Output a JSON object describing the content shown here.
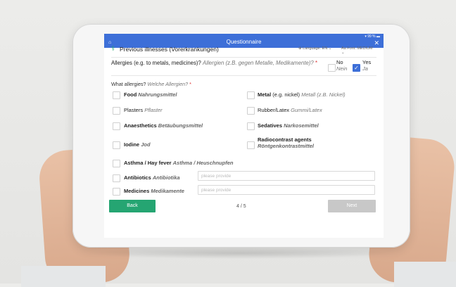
{
  "header": {
    "title": "Questionnaire",
    "status": "▾ 99 % ▬"
  },
  "section": {
    "title": "Previous illnesses (Vorerkrankungen)",
    "language": "Language: EN",
    "font": "Font: MEDIUM"
  },
  "q1": {
    "label_en": "Allergies (e.g. to metals, medicines)?",
    "label_de": "Allergien (z.B. gegen Metalle, Medikamente)?",
    "required": "*",
    "no_en": "No",
    "no_de": "Nein",
    "yes_en": "Yes",
    "yes_de": "Ja",
    "selected": "Yes"
  },
  "q2": {
    "label_en": "What allergies?",
    "label_de": "Welche Allergien?",
    "required": "*"
  },
  "options": {
    "food": {
      "en": "Food",
      "de": "Nahrungsmittel"
    },
    "metal": {
      "en": "Metal",
      "mid": "(e.g. nickel)",
      "de": "Metall (z.B. Nickel)"
    },
    "plasters": {
      "en": "Plasters",
      "de": "Pflaster"
    },
    "rubber": {
      "en": "Rubber/Latex",
      "de": "Gummi/Latex"
    },
    "anaesthetics": {
      "en": "Anaesthetics",
      "de": "Betäubungsmittel"
    },
    "sedatives": {
      "en": "Sedatives",
      "de": "Narkosemittel"
    },
    "iodine": {
      "en": "Iodine",
      "de": "Jod"
    },
    "radiocontrast": {
      "en": "Radiocontrast agents",
      "de": "Röntgenkontrastmittel"
    },
    "asthma": {
      "en": "Asthma / Hay fever",
      "de": "Asthma / Heuschnupfen"
    },
    "antibiotics": {
      "en": "Antibiotics",
      "de": "Antibiotika",
      "placeholder": "please provide"
    },
    "medicines": {
      "en": "Medicines",
      "de": "Medikamente",
      "placeholder": "please provide"
    }
  },
  "footer": {
    "back": "Back",
    "page": "4 / 5",
    "next": "Next"
  },
  "colors": {
    "accent": "#3d6fd8",
    "green": "#25a572",
    "disabled": "#c8c8c8"
  }
}
